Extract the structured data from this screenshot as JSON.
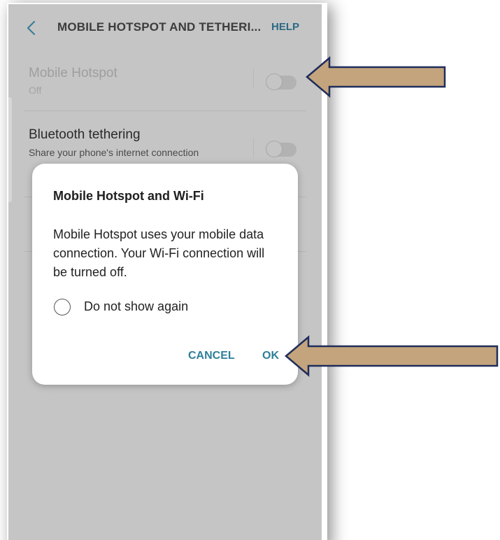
{
  "header": {
    "title": "MOBILE HOTSPOT AND TETHERI...",
    "help_label": "HELP"
  },
  "settings": [
    {
      "title": "Mobile Hotspot",
      "subtitle": "Off",
      "toggle_on": false
    },
    {
      "title": "Bluetooth tethering",
      "subtitle": "Share your phone's internet connection",
      "toggle_on": false
    }
  ],
  "dialog": {
    "title": "Mobile Hotspot and Wi-Fi",
    "body": "Mobile Hotspot uses your mobile data connection. Your Wi-Fi connection will be turned off.",
    "checkbox_label": "Do not show again",
    "checkbox_checked": false,
    "cancel_label": "CANCEL",
    "ok_label": "OK"
  },
  "icons": {
    "back": "chevron-left-icon",
    "annotation_arrow": "left-arrow-icon"
  },
  "colors": {
    "accent": "#2f7f99",
    "help": "#2c6a84",
    "arrow_fill": "#c4a47c",
    "arrow_stroke": "#1f2d5c",
    "overlay": "#c5c5c5"
  }
}
